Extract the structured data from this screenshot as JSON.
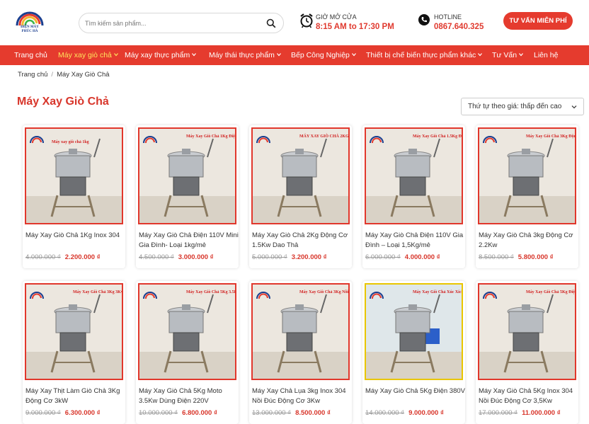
{
  "header": {
    "logo_line1": "ĐIỆN MÁY",
    "logo_line2": "PHÚC HÀ",
    "search_placeholder": "Tìm kiếm sản phẩm...",
    "hours_label": "GIỜ MỞ CỬA",
    "hours_value": "8:15 AM to 17:30 PM",
    "hotline_label": "HOTLINE",
    "hotline_value": "0867.640.325",
    "cta_label": "TƯ VẤN MIỄN PHÍ"
  },
  "nav": {
    "items": [
      {
        "label": "Trang chủ",
        "dropdown": false
      },
      {
        "label": "Máy xay giò chả",
        "dropdown": true,
        "active": true
      },
      {
        "label": "Máy xay thực phẩm",
        "dropdown": true
      },
      {
        "label": "Máy thái thực phẩm",
        "dropdown": true
      },
      {
        "label": "Bếp Công Nghiệp",
        "dropdown": true
      },
      {
        "label": "Thiết bị chế biến thực phẩm khác",
        "dropdown": true
      },
      {
        "label": "Tư Vấn",
        "dropdown": true
      },
      {
        "label": "Liên hệ",
        "dropdown": false
      }
    ]
  },
  "breadcrumb": {
    "home": "Trang chủ",
    "separator": "/",
    "current": "Máy Xay Giò Chả"
  },
  "page_title": "Máy Xay Giò Chả",
  "sort": {
    "selected": "Thứ tự theo giá: thấp đến cao"
  },
  "colors": {
    "accent": "#e53b2e",
    "price": "#d8362b",
    "nav_active": "#ffe45c"
  },
  "products": [
    {
      "name": "Máy Xay Giò Chả 1Kg Inox 304",
      "old_price": "4.000.000 ₫",
      "price": "2.200.000 ₫",
      "image_caption": "Máy xay giò chả 1kg"
    },
    {
      "name": "Máy Xay Giò Chả Điện 110V Mini Gia Đình- Loại 1kg/mẻ",
      "old_price": "4.500.000 ₫",
      "price": "3.000.000 ₫",
      "image_caption": "Máy Xay Giò Chả 1Kg Điện 110V"
    },
    {
      "name": "Máy Xay Giò Chả 2Kg Động Cơ 1.5Kw Dao Thả",
      "old_price": "5.000.000 ₫",
      "price": "3.200.000 ₫",
      "image_caption": "MÁY XAY GIÒ CHẢ 2KG"
    },
    {
      "name": "Máy Xay Giò Chả Điện 110V Gia Đình – Loại 1,5Kg/mẻ",
      "old_price": "6.000.000 ₫",
      "price": "4.000.000 ₫",
      "image_caption": "Máy Xay Giò Chả 1.5Kg Điện 110V"
    },
    {
      "name": "Máy Xay Giò Chả 3kg Động Cơ 2.2Kw",
      "old_price": "8.500.000 ₫",
      "price": "5.800.000 ₫",
      "image_caption": "Máy Xay Giò Chả 3Kg Động Cơ 2.2Kw"
    },
    {
      "name": "Máy Xay Thịt Làm Giò Chả 3Kg Động Cơ 3kW",
      "old_price": "9.000.000 ₫",
      "price": "6.300.000 ₫",
      "image_caption": "Máy Xay Giò Chả 3Kg 3Kw"
    },
    {
      "name": "Máy Xay Giò Chả 5Kg Moto 3.5Kw Dùng Điện 220V",
      "old_price": "10.000.000 ₫",
      "price": "6.800.000 ₫",
      "image_caption": "Máy Xay Giò Chả 5Kg 3.5Kw Điện 220V"
    },
    {
      "name": "Máy Xay Chả Lụa 3kg Inox 304 Nồi Đúc Động Cơ 3Kw",
      "old_price": "13.000.000 ₫",
      "price": "8.500.000 ₫",
      "image_caption": "Máy Xay Giò Chả 3Kg Nồi Đúc"
    },
    {
      "name": "Máy Xay Giò Chả 5Kg Điện 380V",
      "old_price": "14.000.000 ₫",
      "price": "9.000.000 ₫",
      "image_caption": "Máy Xay Giò Chả Xúc Xích 5KG (3Kw) Điện 3 pha"
    },
    {
      "name": "Máy Xay Giò Chả 5Kg Inox 304 Nồi Đúc Động Cơ 3,5Kw",
      "old_price": "17.000.000 ₫",
      "price": "11.000.000 ₫",
      "image_caption": "Máy Xay Giò Chả 5Kg Điện 220V Nồi Đúc"
    }
  ]
}
